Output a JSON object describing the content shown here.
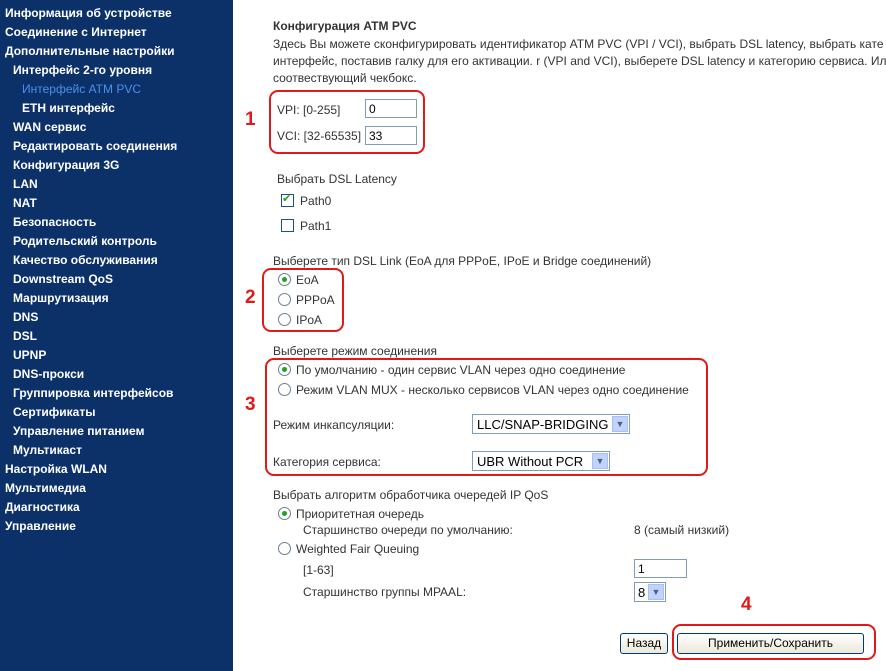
{
  "sidebar": {
    "items": [
      {
        "label": "Информация об устройстве"
      },
      {
        "label": "Соединение с Интернет"
      },
      {
        "label": "Дополнительные настройки"
      },
      {
        "label": "Интерфейс 2-го уровня"
      },
      {
        "label": "Интерфейс ATM PVC"
      },
      {
        "label": "ETH интерфейс"
      },
      {
        "label": "WAN сервис"
      },
      {
        "label": "Редактировать соединения"
      },
      {
        "label": "Конфигурация 3G"
      },
      {
        "label": "LAN"
      },
      {
        "label": "NAT"
      },
      {
        "label": "Безопасность"
      },
      {
        "label": "Родительский контроль"
      },
      {
        "label": "Качество обслуживания"
      },
      {
        "label": "Downstream QoS"
      },
      {
        "label": "Маршрутизация"
      },
      {
        "label": "DNS"
      },
      {
        "label": "DSL"
      },
      {
        "label": "UPNP"
      },
      {
        "label": "DNS-прокси"
      },
      {
        "label": "Группировка интерфейсов"
      },
      {
        "label": "Сертификаты"
      },
      {
        "label": "Управление питанием"
      },
      {
        "label": "Мультикаст"
      },
      {
        "label": "Настройка WLAN"
      },
      {
        "label": "Мультимедиа"
      },
      {
        "label": "Диагностика"
      },
      {
        "label": "Управление"
      }
    ]
  },
  "main": {
    "title": "Конфигурация ATM PVC",
    "description": "Здесь Вы можете сконфигурировать идентификатор ATM PVC (VPI / VCI), выбрать DSL latency, выбрать кате интерфейс, поставив галку для его активации. r (VPI and VCI), выберете DSL latency и категорию сервиса. Ил соотвествующий чекбокс.",
    "vpi": {
      "label": "VPI: [0-255]",
      "value": "0"
    },
    "vci": {
      "label": "VCI: [32-65535]",
      "value": "33"
    },
    "latency": {
      "heading": "Выбрать DSL Latency",
      "path0": "Path0",
      "path1": "Path1"
    },
    "link_type": {
      "heading": "Выберете тип DSL Link (EoA для PPPoE, IPoE и Bridge соединений)",
      "options": [
        "EoA",
        "PPPoA",
        "IPoA"
      ]
    },
    "conn_mode": {
      "heading": "Выберете режим соединения",
      "default": "По умолчанию - один сервис VLAN через одно соединение",
      "vlan_mux": "Режим VLAN MUX - несколько сервисов VLAN через одно соединение",
      "encap_label": "Режим инкапсуляции:",
      "encap_value": "LLC/SNAP-BRIDGING",
      "service_label": "Категория сервиса:",
      "service_value": "UBR Without PCR"
    },
    "qos": {
      "heading": "Выбрать алгоритм обработчика очередей IP QoS",
      "priority": "Приоритетная очередь",
      "default_prec_label": "Старшинство очереди по умолчанию:",
      "default_prec_value": "8 (самый низкий)",
      "wfq": "Weighted Fair Queuing",
      "range_label": "[1-63]",
      "range_value": "1",
      "mpaal_label": "Старшинство группы MPAAL:",
      "mpaal_value": "8"
    },
    "buttons": {
      "back": "Назад",
      "apply": "Применить/Сохранить"
    },
    "annotations": [
      "1",
      "2",
      "3",
      "4"
    ]
  },
  "colors": {
    "sidebar_bg": "#0c3169",
    "active_link": "#4a90e8",
    "annotation_red": "#e01a1a",
    "check_green": "#21a121"
  }
}
